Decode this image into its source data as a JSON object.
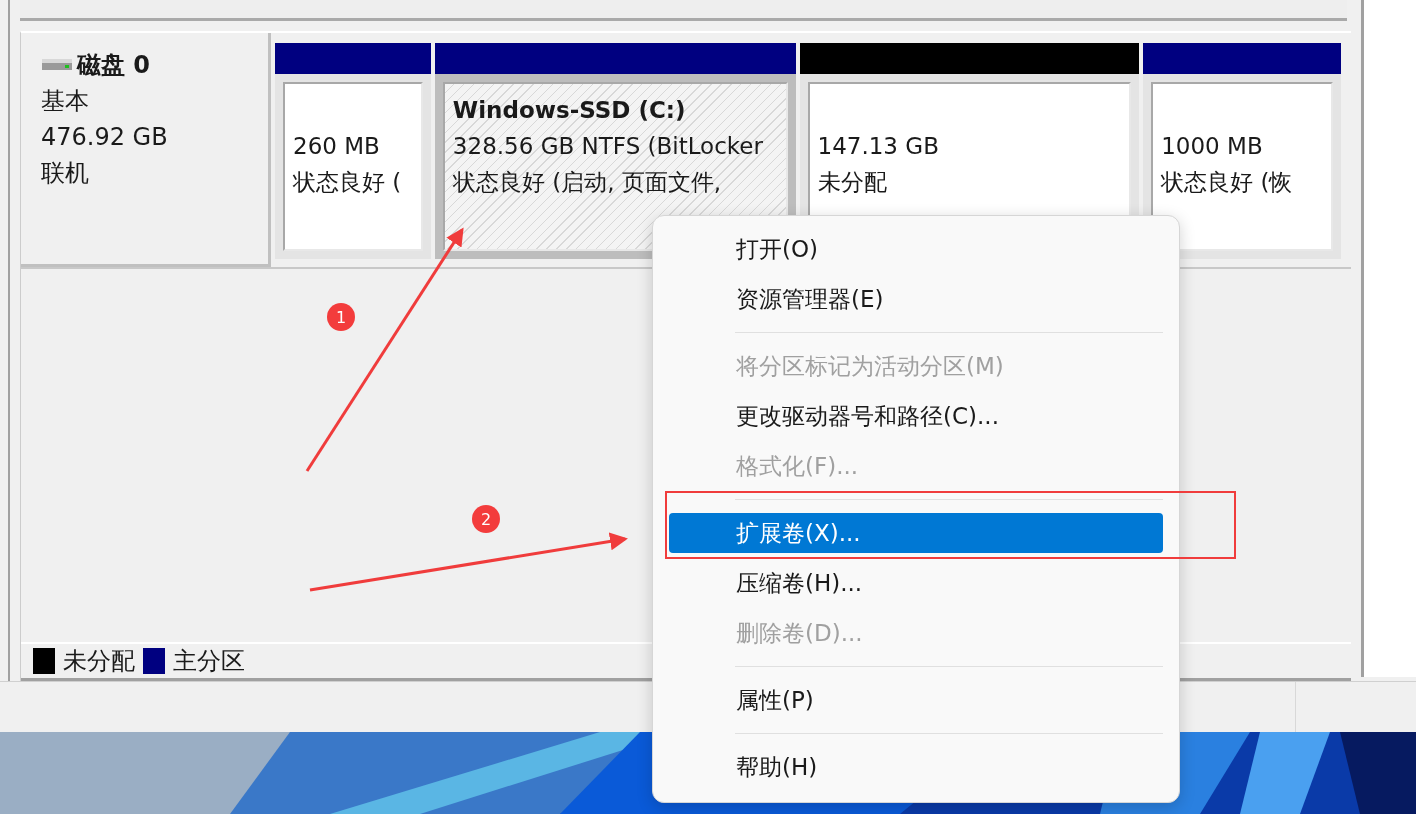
{
  "disk": {
    "name": "磁盘 0",
    "type": "基本",
    "size": "476.92 GB",
    "status": "联机"
  },
  "partitions": [
    {
      "color": "#000080",
      "selected": false,
      "lines": [
        "260 MB",
        "状态良好 ("
      ]
    },
    {
      "color": "#000080",
      "selected": true,
      "label": "Windows-SSD  (C:)",
      "lines": [
        "328.56 GB NTFS (BitLocker",
        "状态良好 (启动, 页面文件,"
      ]
    },
    {
      "color": "#000000",
      "selected": false,
      "lines": [
        "147.13 GB",
        "未分配"
      ]
    },
    {
      "color": "#000080",
      "selected": false,
      "lines": [
        "1000 MB",
        "状态良好 (恢"
      ]
    }
  ],
  "legend": [
    {
      "color": "#000000",
      "label": "未分配"
    },
    {
      "color": "#000080",
      "label": "主分区"
    }
  ],
  "context_menu": [
    {
      "kind": "item",
      "label": "打开(O)",
      "disabled": false,
      "selected": false
    },
    {
      "kind": "item",
      "label": "资源管理器(E)",
      "disabled": false,
      "selected": false
    },
    {
      "kind": "separator"
    },
    {
      "kind": "item",
      "label": "将分区标记为活动分区(M)",
      "disabled": true,
      "selected": false
    },
    {
      "kind": "item",
      "label": "更改驱动器号和路径(C)...",
      "disabled": false,
      "selected": false
    },
    {
      "kind": "item",
      "label": "格式化(F)...",
      "disabled": true,
      "selected": false
    },
    {
      "kind": "separator"
    },
    {
      "kind": "item",
      "label": "扩展卷(X)...",
      "disabled": false,
      "selected": true
    },
    {
      "kind": "item",
      "label": "压缩卷(H)...",
      "disabled": false,
      "selected": false
    },
    {
      "kind": "item",
      "label": "删除卷(D)...",
      "disabled": true,
      "selected": false
    },
    {
      "kind": "separator"
    },
    {
      "kind": "item",
      "label": "属性(P)",
      "disabled": false,
      "selected": false
    },
    {
      "kind": "separator"
    },
    {
      "kind": "item",
      "label": "帮助(H)",
      "disabled": false,
      "selected": false
    }
  ],
  "annotations": [
    {
      "label": "1"
    },
    {
      "label": "2"
    }
  ]
}
